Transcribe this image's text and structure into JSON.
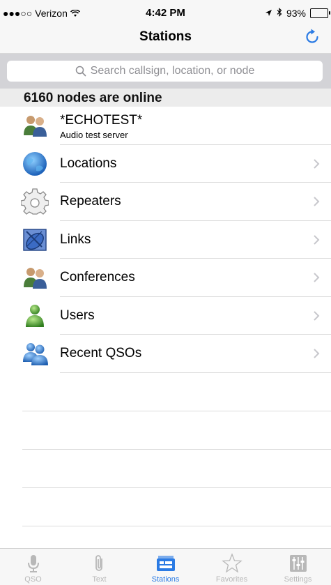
{
  "status_bar": {
    "carrier": "●●●○○ Verizon",
    "time": "4:42 PM",
    "battery_text": "93%",
    "battery_level": 0.93
  },
  "nav": {
    "title": "Stations"
  },
  "search": {
    "placeholder": "Search callsign, location, or node"
  },
  "section": {
    "header": "6160 nodes are online"
  },
  "list": {
    "echotest": {
      "title": "*ECHOTEST*",
      "subtitle": "Audio test server"
    },
    "items": [
      {
        "label": "Locations",
        "icon": "globe-icon"
      },
      {
        "label": "Repeaters",
        "icon": "gear-icon"
      },
      {
        "label": "Links",
        "icon": "satellite-dish-icon"
      },
      {
        "label": "Conferences",
        "icon": "group-icon"
      },
      {
        "label": "Users",
        "icon": "user-icon"
      },
      {
        "label": "Recent QSOs",
        "icon": "users-icon"
      }
    ]
  },
  "tabs": [
    {
      "label": "QSO",
      "icon": "microphone-icon",
      "active": false
    },
    {
      "label": "Text",
      "icon": "paperclip-icon",
      "active": false
    },
    {
      "label": "Stations",
      "icon": "stations-icon",
      "active": true
    },
    {
      "label": "Favorites",
      "icon": "star-icon",
      "active": false
    },
    {
      "label": "Settings",
      "icon": "sliders-icon",
      "active": false
    }
  ],
  "colors": {
    "accent": "#2b7be4",
    "tab_inactive": "#b8b8b8"
  }
}
